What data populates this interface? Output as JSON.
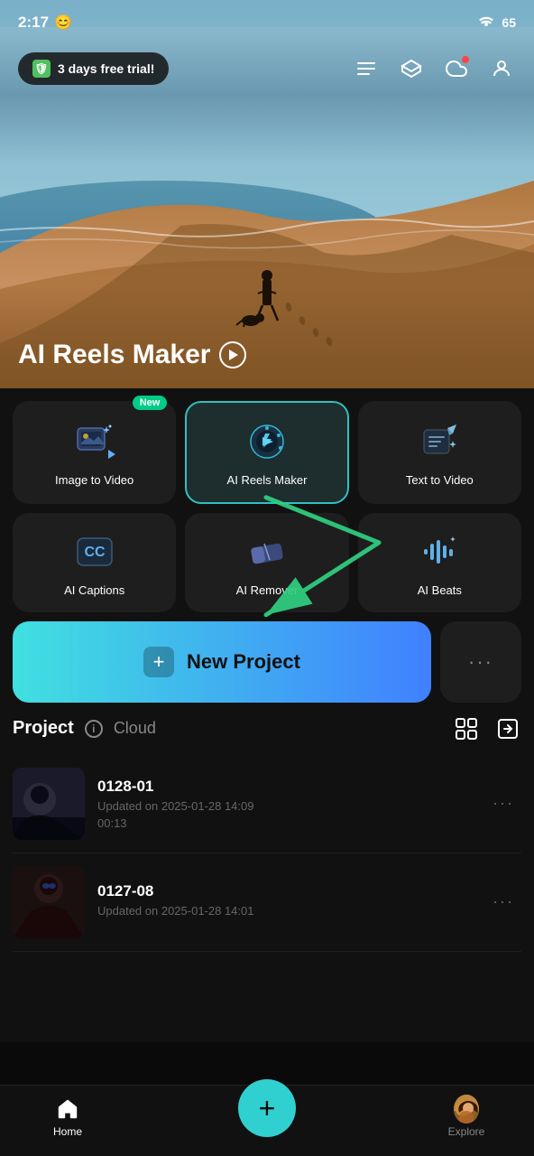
{
  "statusBar": {
    "time": "2:17",
    "emoji": "😊",
    "battery": "65"
  },
  "topNav": {
    "trialBadge": "3 days free trial!",
    "shieldEmoji": "🛡️"
  },
  "hero": {
    "title": "AI Reels Maker",
    "playButtonLabel": "▶"
  },
  "tools": [
    {
      "id": "image-to-video",
      "label": "Image to Video",
      "icon": "🎬",
      "isNew": true,
      "isActive": false
    },
    {
      "id": "ai-reels-maker",
      "label": "AI Reels Maker",
      "icon": "⚡",
      "isNew": false,
      "isActive": true
    },
    {
      "id": "text-to-video",
      "label": "Text  to Video",
      "icon": "✏️",
      "isNew": false,
      "isActive": false
    },
    {
      "id": "ai-captions",
      "label": "AI Captions",
      "icon": "CC",
      "isNew": false,
      "isActive": false
    },
    {
      "id": "ai-remover",
      "label": "AI Remover",
      "icon": "🔷",
      "isNew": false,
      "isActive": false
    },
    {
      "id": "ai-beats",
      "label": "AI Beats",
      "icon": "🎵",
      "isNew": false,
      "isActive": false
    }
  ],
  "actions": {
    "newProjectLabel": "New Project",
    "moreDots": "···"
  },
  "projects": {
    "title": "Project",
    "cloudTab": "Cloud",
    "items": [
      {
        "id": "proj1",
        "name": "0128-01",
        "updatedDate": "Updated on 2025-01-28 14:09",
        "duration": "00:13"
      },
      {
        "id": "proj2",
        "name": "0127-08",
        "updatedDate": "Updated on 2025-01-28 14:01",
        "duration": ""
      }
    ]
  },
  "bottomNav": {
    "homeLabel": "Home",
    "exploreLabel": "Explore",
    "fabIcon": "+"
  }
}
